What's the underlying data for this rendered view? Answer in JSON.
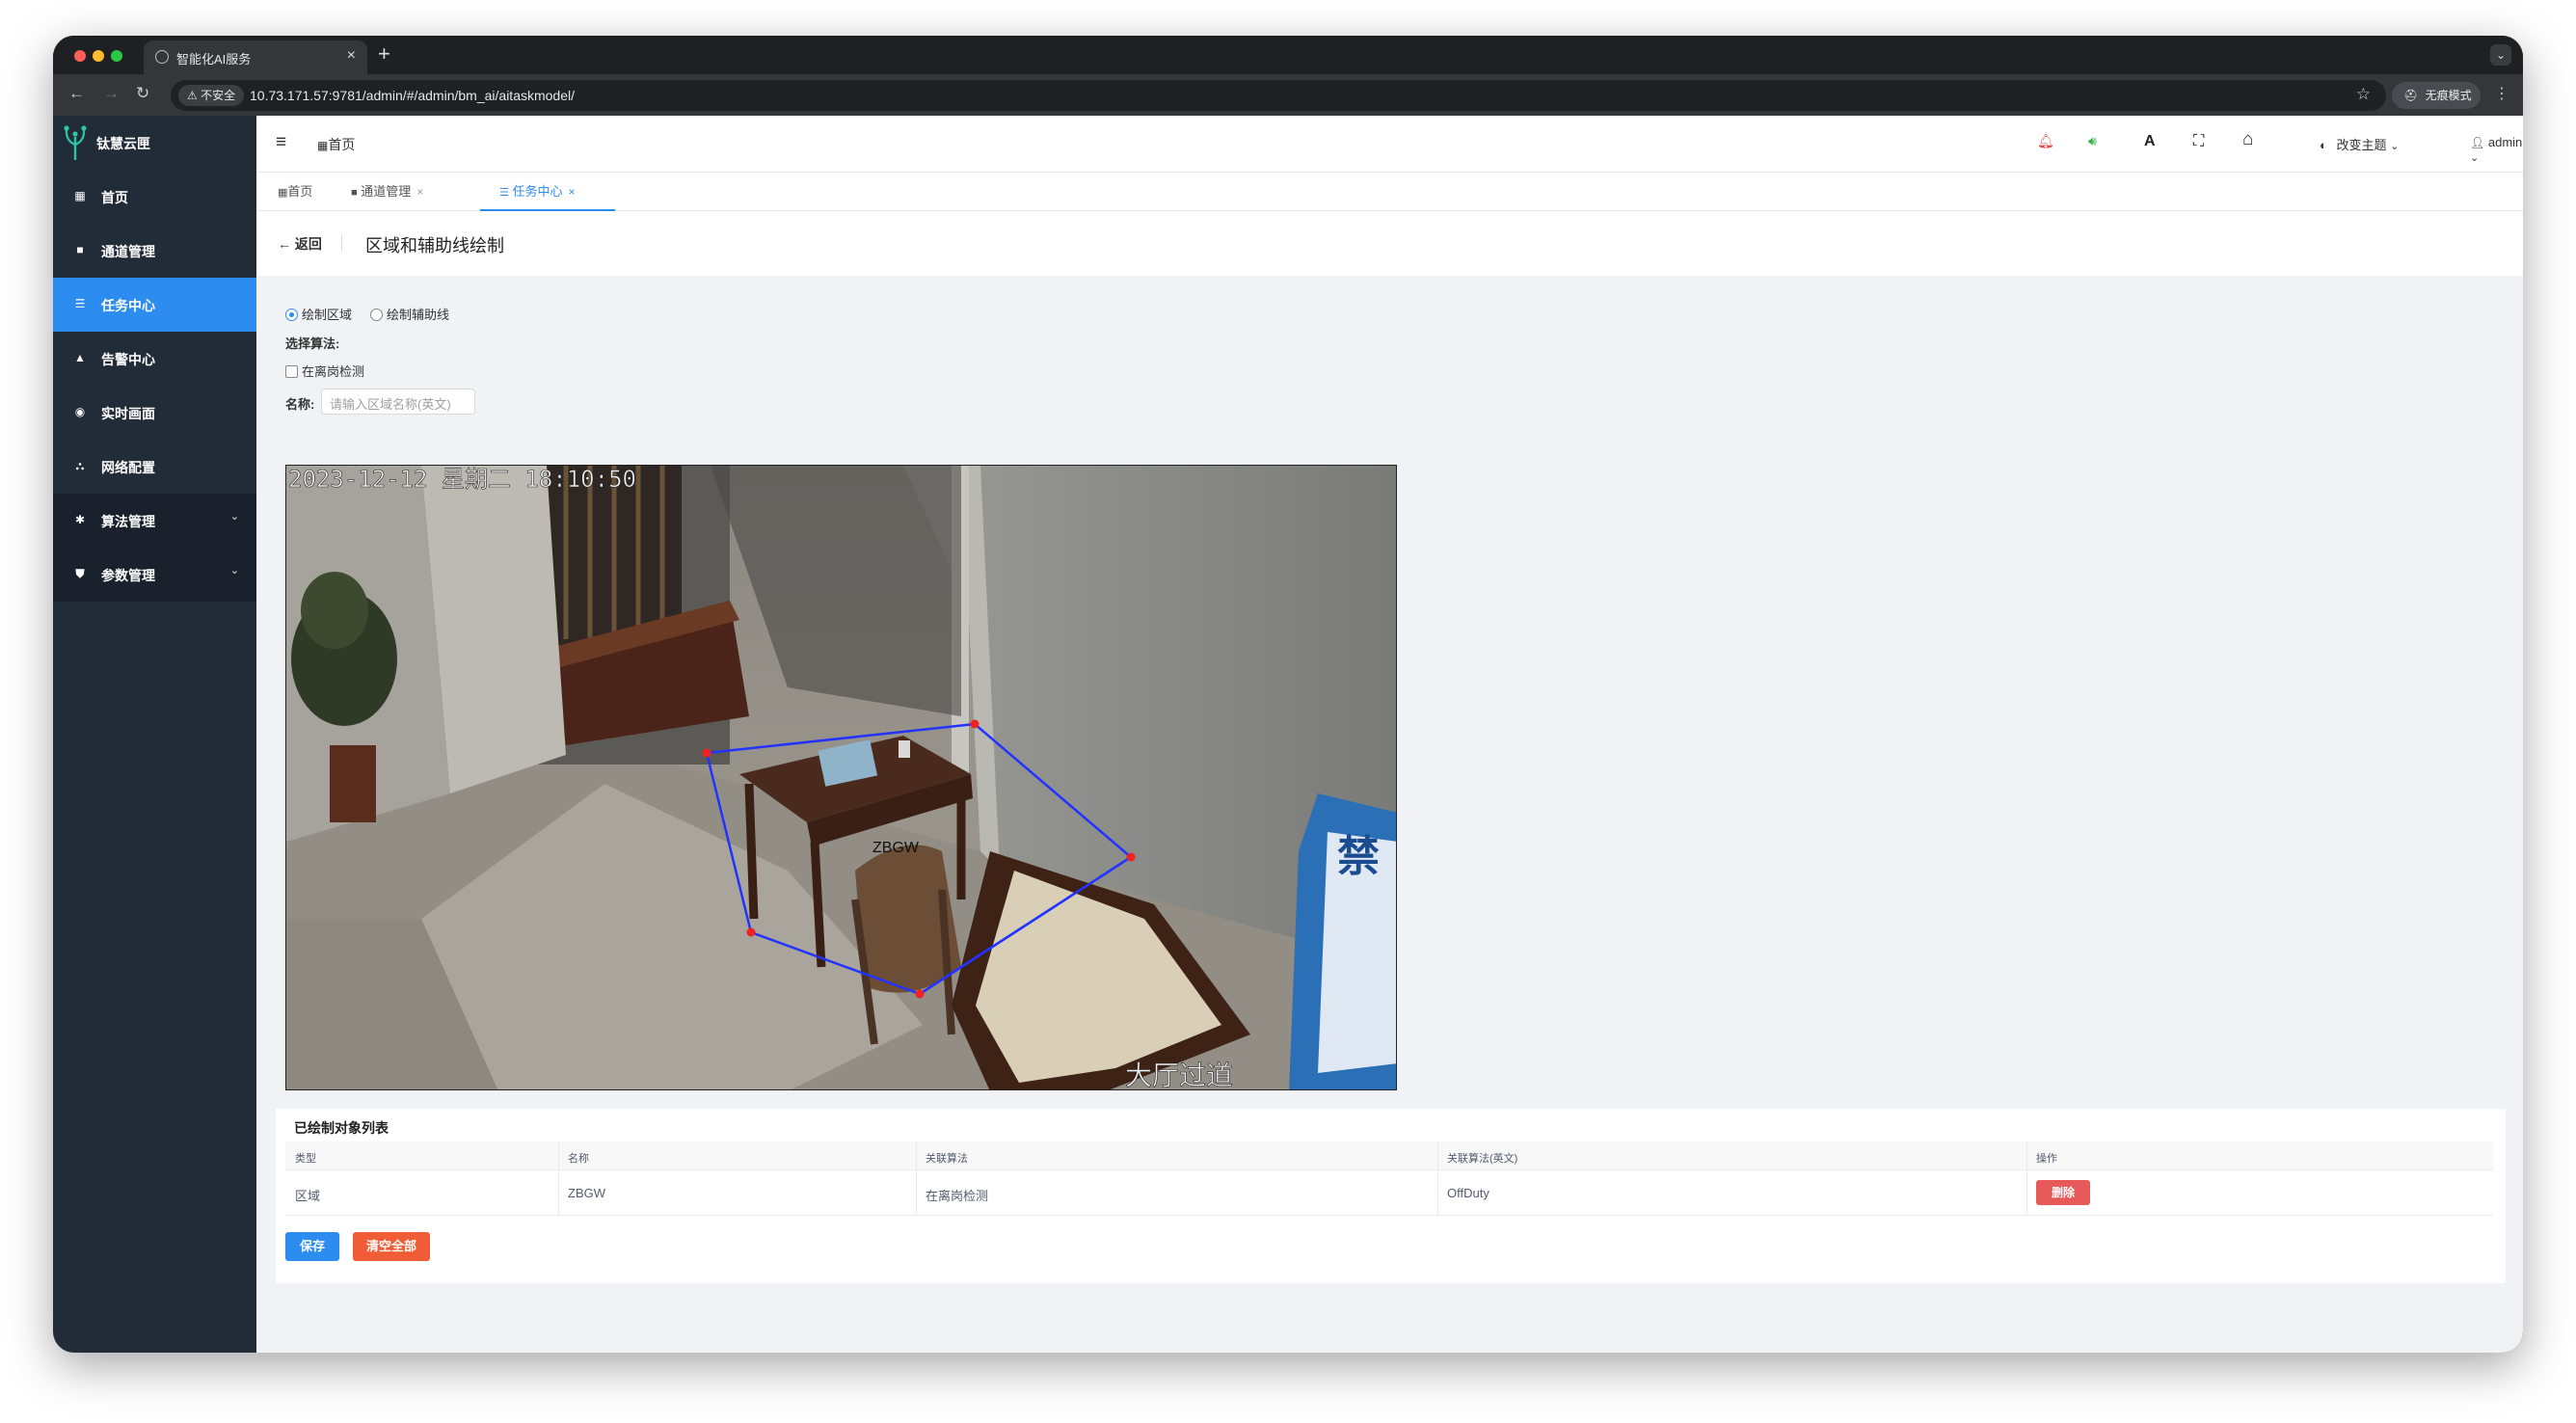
{
  "browser": {
    "tab_title": "智能化AI服务",
    "tab_close": "×",
    "new_tab": "+",
    "insecure_label": "不安全",
    "url": "10.73.171.57:9781/admin/#/admin/bm_ai/aitaskmodel/",
    "incognito_label": "无痕模式",
    "back_glyph": "←",
    "forward_glyph": "→",
    "reload_glyph": "↻",
    "star_glyph": "☆",
    "kebab_glyph": "⋮",
    "menu_glyph": "⌄"
  },
  "app": {
    "logo_text": "钛慧云匣"
  },
  "sidebar": {
    "items": [
      {
        "label": "首页",
        "icon": "grid-icon",
        "glyph": "▦"
      },
      {
        "label": "通道管理",
        "icon": "video-camera-icon",
        "glyph": "■"
      },
      {
        "label": "任务中心",
        "icon": "task-list-icon",
        "glyph": "☰"
      },
      {
        "label": "告警中心",
        "icon": "bell-icon",
        "glyph": "▲"
      },
      {
        "label": "实时画面",
        "icon": "eye-icon",
        "glyph": "◉"
      },
      {
        "label": "网络配置",
        "icon": "network-icon",
        "glyph": "⛬"
      },
      {
        "label": "算法管理",
        "icon": "algorithm-icon",
        "glyph": "✱",
        "chevron": "⌄"
      },
      {
        "label": "参数管理",
        "icon": "shield-icon",
        "glyph": "⛊",
        "chevron": "⌄"
      }
    ],
    "active_index": 2
  },
  "header": {
    "hamburger": "≡",
    "breadcrumb_icon": "▦",
    "breadcrumb": "首页",
    "theme_label": "改变主题",
    "theme_chevron": "⌄",
    "user_label": "admin",
    "user_chevron": "⌄",
    "icons": {
      "bell": "🔔",
      "volume": "🔊",
      "font": "A",
      "fullscreen": "⛶",
      "home": "⌂",
      "palette": "◐",
      "user": "👤"
    }
  },
  "page_tabs": [
    {
      "label": "首页",
      "icon": "▦",
      "closable": false
    },
    {
      "label": "通道管理",
      "icon": "■",
      "closable": true
    },
    {
      "label": "任务中心",
      "icon": "☰",
      "closable": true
    }
  ],
  "page_tab_close": "×",
  "page_header": {
    "back_arrow": "←",
    "back_label": "返回",
    "title": "区域和辅助线绘制"
  },
  "form": {
    "radio_area": "绘制区域",
    "radio_line": "绘制辅助线",
    "algo_label": "选择算法:",
    "algo_option": "在离岗检测",
    "name_label": "名称:",
    "name_placeholder": "请输入区域名称(英文)"
  },
  "camera": {
    "osd_time": "2023-12-12 星期二 18:10:50",
    "osd_location": "大厅过道",
    "region_label": "ZBGW",
    "region_color": "#2233ff",
    "vertex_color": "#ee2222",
    "poster_text": "禁"
  },
  "table": {
    "title": "已绘制对象列表",
    "headers": [
      "类型",
      "名称",
      "关联算法",
      "关联算法(英文)",
      "操作"
    ],
    "rows": [
      {
        "type": "区域",
        "name": "ZBGW",
        "algo": "在离岗检测",
        "algo_en": "OffDuty",
        "action": "删除"
      }
    ]
  },
  "actions": {
    "save": "保存",
    "clear_all": "清空全部"
  },
  "colors": {
    "primary": "#2d8cf0",
    "danger": "#ed4014",
    "sidebar_bg": "#222b38"
  }
}
